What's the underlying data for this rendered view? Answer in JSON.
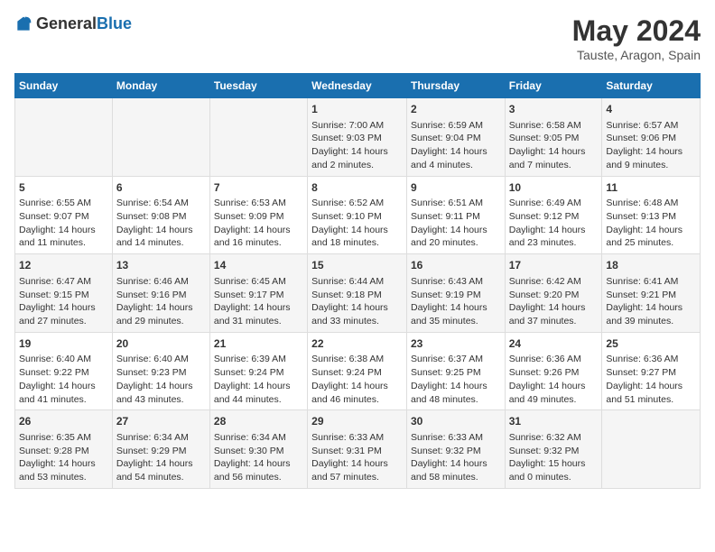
{
  "logo": {
    "text_general": "General",
    "text_blue": "Blue"
  },
  "header": {
    "title": "May 2024",
    "subtitle": "Tauste, Aragon, Spain"
  },
  "days_of_week": [
    "Sunday",
    "Monday",
    "Tuesday",
    "Wednesday",
    "Thursday",
    "Friday",
    "Saturday"
  ],
  "weeks": [
    [
      {
        "day": "",
        "info": ""
      },
      {
        "day": "",
        "info": ""
      },
      {
        "day": "",
        "info": ""
      },
      {
        "day": "1",
        "info": "Sunrise: 7:00 AM\nSunset: 9:03 PM\nDaylight: 14 hours and 2 minutes."
      },
      {
        "day": "2",
        "info": "Sunrise: 6:59 AM\nSunset: 9:04 PM\nDaylight: 14 hours and 4 minutes."
      },
      {
        "day": "3",
        "info": "Sunrise: 6:58 AM\nSunset: 9:05 PM\nDaylight: 14 hours and 7 minutes."
      },
      {
        "day": "4",
        "info": "Sunrise: 6:57 AM\nSunset: 9:06 PM\nDaylight: 14 hours and 9 minutes."
      }
    ],
    [
      {
        "day": "5",
        "info": "Sunrise: 6:55 AM\nSunset: 9:07 PM\nDaylight: 14 hours and 11 minutes."
      },
      {
        "day": "6",
        "info": "Sunrise: 6:54 AM\nSunset: 9:08 PM\nDaylight: 14 hours and 14 minutes."
      },
      {
        "day": "7",
        "info": "Sunrise: 6:53 AM\nSunset: 9:09 PM\nDaylight: 14 hours and 16 minutes."
      },
      {
        "day": "8",
        "info": "Sunrise: 6:52 AM\nSunset: 9:10 PM\nDaylight: 14 hours and 18 minutes."
      },
      {
        "day": "9",
        "info": "Sunrise: 6:51 AM\nSunset: 9:11 PM\nDaylight: 14 hours and 20 minutes."
      },
      {
        "day": "10",
        "info": "Sunrise: 6:49 AM\nSunset: 9:12 PM\nDaylight: 14 hours and 23 minutes."
      },
      {
        "day": "11",
        "info": "Sunrise: 6:48 AM\nSunset: 9:13 PM\nDaylight: 14 hours and 25 minutes."
      }
    ],
    [
      {
        "day": "12",
        "info": "Sunrise: 6:47 AM\nSunset: 9:15 PM\nDaylight: 14 hours and 27 minutes."
      },
      {
        "day": "13",
        "info": "Sunrise: 6:46 AM\nSunset: 9:16 PM\nDaylight: 14 hours and 29 minutes."
      },
      {
        "day": "14",
        "info": "Sunrise: 6:45 AM\nSunset: 9:17 PM\nDaylight: 14 hours and 31 minutes."
      },
      {
        "day": "15",
        "info": "Sunrise: 6:44 AM\nSunset: 9:18 PM\nDaylight: 14 hours and 33 minutes."
      },
      {
        "day": "16",
        "info": "Sunrise: 6:43 AM\nSunset: 9:19 PM\nDaylight: 14 hours and 35 minutes."
      },
      {
        "day": "17",
        "info": "Sunrise: 6:42 AM\nSunset: 9:20 PM\nDaylight: 14 hours and 37 minutes."
      },
      {
        "day": "18",
        "info": "Sunrise: 6:41 AM\nSunset: 9:21 PM\nDaylight: 14 hours and 39 minutes."
      }
    ],
    [
      {
        "day": "19",
        "info": "Sunrise: 6:40 AM\nSunset: 9:22 PM\nDaylight: 14 hours and 41 minutes."
      },
      {
        "day": "20",
        "info": "Sunrise: 6:40 AM\nSunset: 9:23 PM\nDaylight: 14 hours and 43 minutes."
      },
      {
        "day": "21",
        "info": "Sunrise: 6:39 AM\nSunset: 9:24 PM\nDaylight: 14 hours and 44 minutes."
      },
      {
        "day": "22",
        "info": "Sunrise: 6:38 AM\nSunset: 9:24 PM\nDaylight: 14 hours and 46 minutes."
      },
      {
        "day": "23",
        "info": "Sunrise: 6:37 AM\nSunset: 9:25 PM\nDaylight: 14 hours and 48 minutes."
      },
      {
        "day": "24",
        "info": "Sunrise: 6:36 AM\nSunset: 9:26 PM\nDaylight: 14 hours and 49 minutes."
      },
      {
        "day": "25",
        "info": "Sunrise: 6:36 AM\nSunset: 9:27 PM\nDaylight: 14 hours and 51 minutes."
      }
    ],
    [
      {
        "day": "26",
        "info": "Sunrise: 6:35 AM\nSunset: 9:28 PM\nDaylight: 14 hours and 53 minutes."
      },
      {
        "day": "27",
        "info": "Sunrise: 6:34 AM\nSunset: 9:29 PM\nDaylight: 14 hours and 54 minutes."
      },
      {
        "day": "28",
        "info": "Sunrise: 6:34 AM\nSunset: 9:30 PM\nDaylight: 14 hours and 56 minutes."
      },
      {
        "day": "29",
        "info": "Sunrise: 6:33 AM\nSunset: 9:31 PM\nDaylight: 14 hours and 57 minutes."
      },
      {
        "day": "30",
        "info": "Sunrise: 6:33 AM\nSunset: 9:32 PM\nDaylight: 14 hours and 58 minutes."
      },
      {
        "day": "31",
        "info": "Sunrise: 6:32 AM\nSunset: 9:32 PM\nDaylight: 15 hours and 0 minutes."
      },
      {
        "day": "",
        "info": ""
      }
    ]
  ]
}
